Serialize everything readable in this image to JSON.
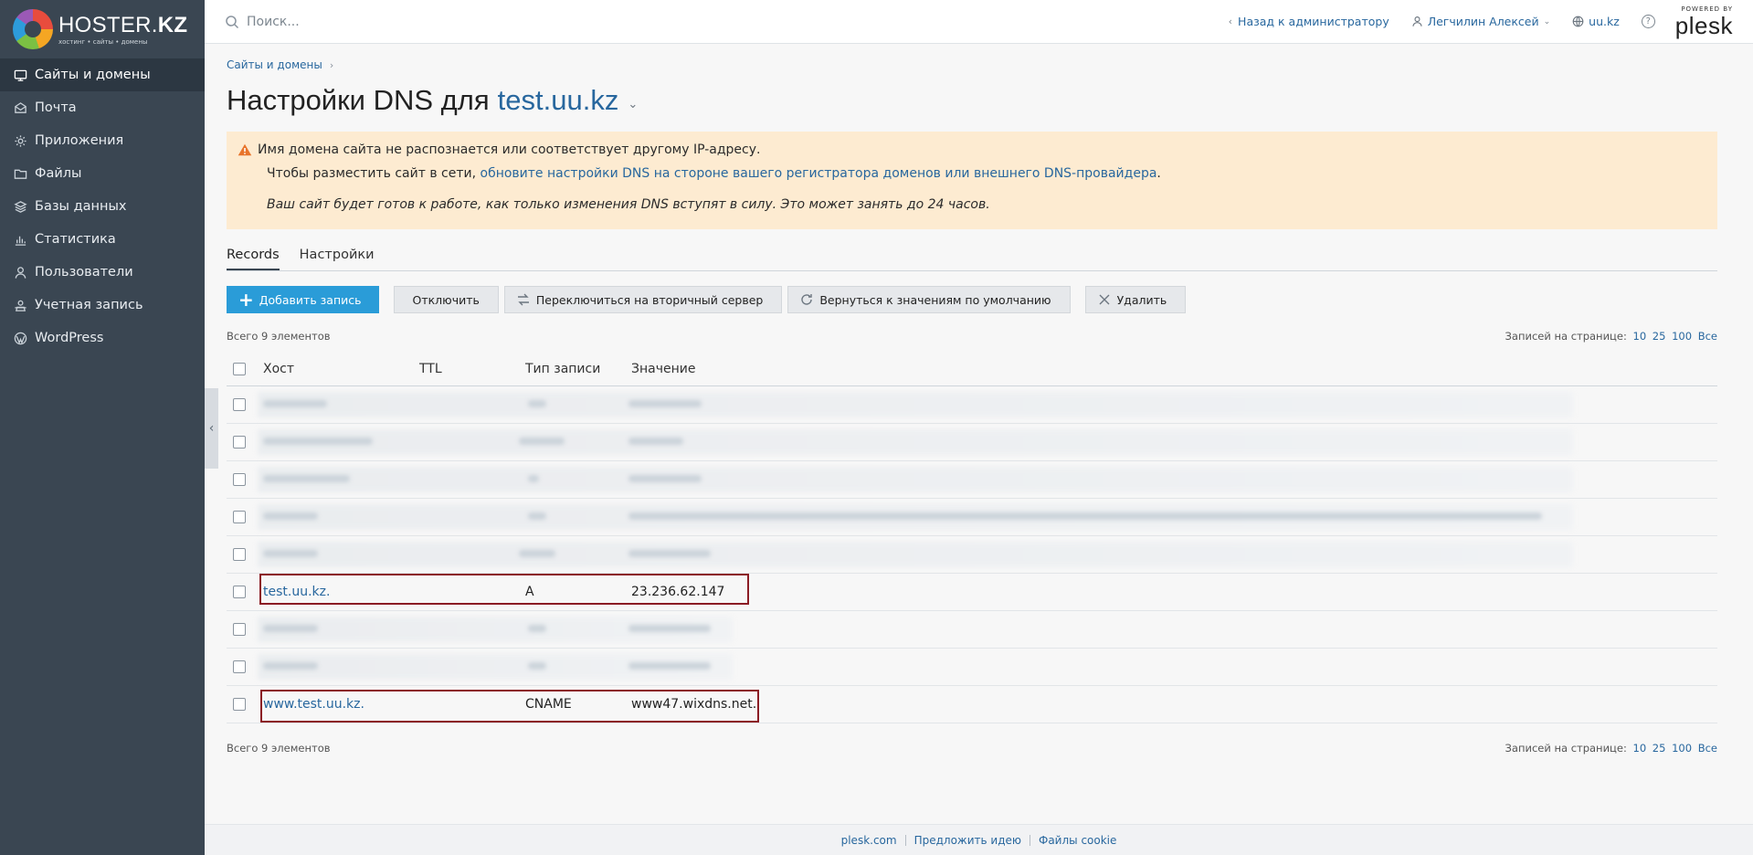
{
  "brand": {
    "name_light": "HOSTER.",
    "name_bold": "KZ",
    "tagline": "хостинг • сайты • домены"
  },
  "sidebar": {
    "items": [
      {
        "label": "Сайты и домены",
        "icon": "monitor-icon",
        "active": true
      },
      {
        "label": "Почта",
        "icon": "mail-icon"
      },
      {
        "label": "Приложения",
        "icon": "gear-icon"
      },
      {
        "label": "Файлы",
        "icon": "folder-icon"
      },
      {
        "label": "Базы данных",
        "icon": "database-icon"
      },
      {
        "label": "Статистика",
        "icon": "chart-icon"
      },
      {
        "label": "Пользователи",
        "icon": "user-icon"
      },
      {
        "label": "Учетная запись",
        "icon": "account-icon"
      },
      {
        "label": "WordPress",
        "icon": "wordpress-icon"
      }
    ]
  },
  "topbar": {
    "search_placeholder": "Поиск...",
    "back_admin": "Назад к администратору",
    "user_name": "Легчилин Алексей",
    "domain": "uu.kz",
    "help": "?",
    "powered_by": "POWERED BY",
    "plesk": "plesk"
  },
  "breadcrumb": {
    "item": "Сайты и домены"
  },
  "page": {
    "title_prefix": "Настройки DNS для",
    "title_domain": "test.uu.kz"
  },
  "warning": {
    "line1": "Имя домена сайта не распознается или соответствует другому IP-адресу.",
    "line2_prefix": "Чтобы разместить сайт в сети, ",
    "line2_link": "обновите настройки DNS на стороне вашего регистратора доменов или внешнего DNS-провайдера",
    "line2_suffix": ".",
    "line3": "Ваш сайт будет готов к работе, как только изменения DNS вступят в силу. Это может занять до 24 часов."
  },
  "tabs": [
    {
      "label": "Records",
      "active": true
    },
    {
      "label": "Настройки"
    }
  ],
  "toolbar": {
    "add": "Добавить запись",
    "disable": "Отключить",
    "switch_secondary": "Переключиться на вторичный сервер",
    "restore_defaults": "Вернуться к значениям по умолчанию",
    "delete": "Удалить"
  },
  "list": {
    "total": "Всего 9 элементов",
    "per_page_label": "Записей на странице:",
    "per_page_options": [
      "10",
      "25",
      "100",
      "Все"
    ]
  },
  "table": {
    "columns": {
      "host": "Хост",
      "ttl": "TTL",
      "type": "Тип записи",
      "value": "Значение"
    },
    "visible_rows": [
      {
        "host": "test.uu.kz.",
        "ttl": "",
        "type": "A",
        "value": "23.236.62.147"
      },
      {
        "host": "www.test.uu.kz.",
        "ttl": "",
        "type": "CNAME",
        "value": "www47.wixdns.net."
      }
    ]
  },
  "footer": {
    "links": [
      "plesk.com",
      "Предложить идею",
      "Файлы cookie"
    ]
  },
  "colors": {
    "sidebar": "#3a4652",
    "accent": "#2a9cd8",
    "link": "#28679e",
    "warning_bg": "#fdebd1",
    "highlight": "#8b1c24"
  }
}
